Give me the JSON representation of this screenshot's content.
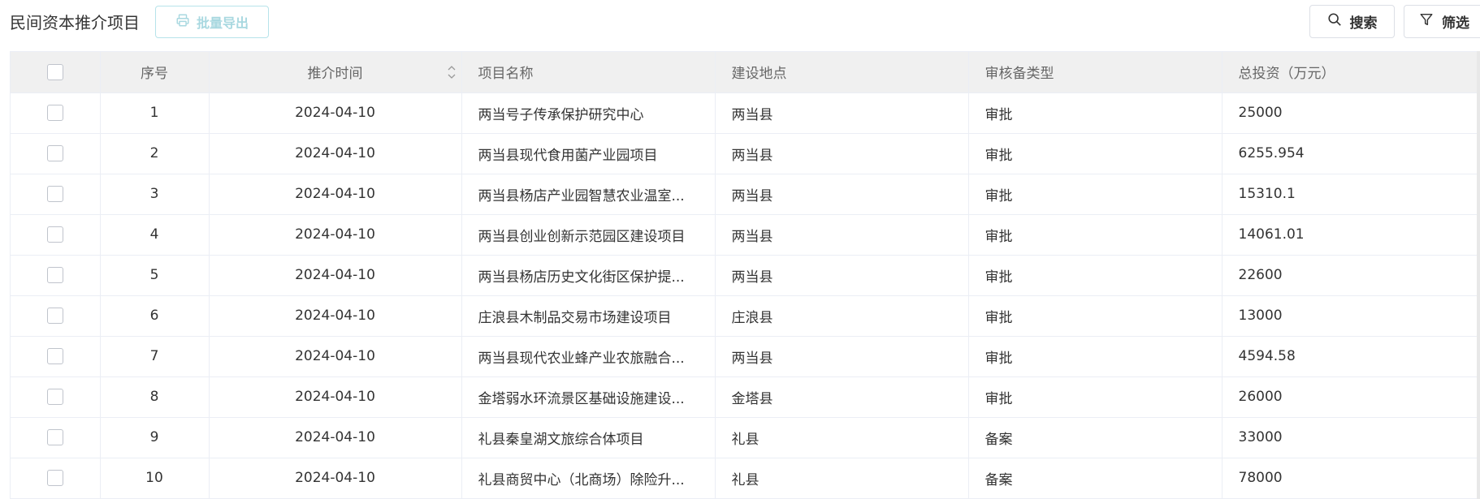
{
  "header": {
    "title": "民间资本推介项目",
    "export_label": "批量导出",
    "search_label": "搜索",
    "filter_label": "筛选"
  },
  "table": {
    "columns": {
      "seq": "序号",
      "date": "推介时间",
      "name": "项目名称",
      "location": "建设地点",
      "review_type": "审核备类型",
      "investment": "总投资（万元）"
    },
    "rows": [
      {
        "seq": "1",
        "date": "2024-04-10",
        "name": "两当号子传承保护研究中心",
        "location": "两当县",
        "review_type": "审批",
        "investment": "25000"
      },
      {
        "seq": "2",
        "date": "2024-04-10",
        "name": "两当县现代食用菌产业园项目",
        "location": "两当县",
        "review_type": "审批",
        "investment": "6255.954"
      },
      {
        "seq": "3",
        "date": "2024-04-10",
        "name": "两当县杨店产业园智慧农业温室...",
        "location": "两当县",
        "review_type": "审批",
        "investment": "15310.1"
      },
      {
        "seq": "4",
        "date": "2024-04-10",
        "name": "两当县创业创新示范园区建设项目",
        "location": "两当县",
        "review_type": "审批",
        "investment": "14061.01"
      },
      {
        "seq": "5",
        "date": "2024-04-10",
        "name": "两当县杨店历史文化街区保护提...",
        "location": "两当县",
        "review_type": "审批",
        "investment": "22600"
      },
      {
        "seq": "6",
        "date": "2024-04-10",
        "name": "庄浪县木制品交易市场建设项目",
        "location": "庄浪县",
        "review_type": "审批",
        "investment": "13000"
      },
      {
        "seq": "7",
        "date": "2024-04-10",
        "name": "两当县现代农业蜂产业农旅融合...",
        "location": "两当县",
        "review_type": "审批",
        "investment": "4594.58"
      },
      {
        "seq": "8",
        "date": "2024-04-10",
        "name": "金塔弱水环流景区基础设施建设...",
        "location": "金塔县",
        "review_type": "审批",
        "investment": "26000"
      },
      {
        "seq": "9",
        "date": "2024-04-10",
        "name": "礼县秦皇湖文旅综合体项目",
        "location": "礼县",
        "review_type": "备案",
        "investment": "33000"
      },
      {
        "seq": "10",
        "date": "2024-04-10",
        "name": "礼县商贸中心（北商场）除险升...",
        "location": "礼县",
        "review_type": "备案",
        "investment": "78000"
      }
    ]
  },
  "colors": {
    "accent_disabled": "#a8d8e0",
    "header_bg": "#f0f0f0",
    "border": "#ebeef5"
  },
  "icons": {
    "export": "printer-icon",
    "search": "search-icon",
    "filter": "filter-icon",
    "sort": "sort-icon"
  }
}
